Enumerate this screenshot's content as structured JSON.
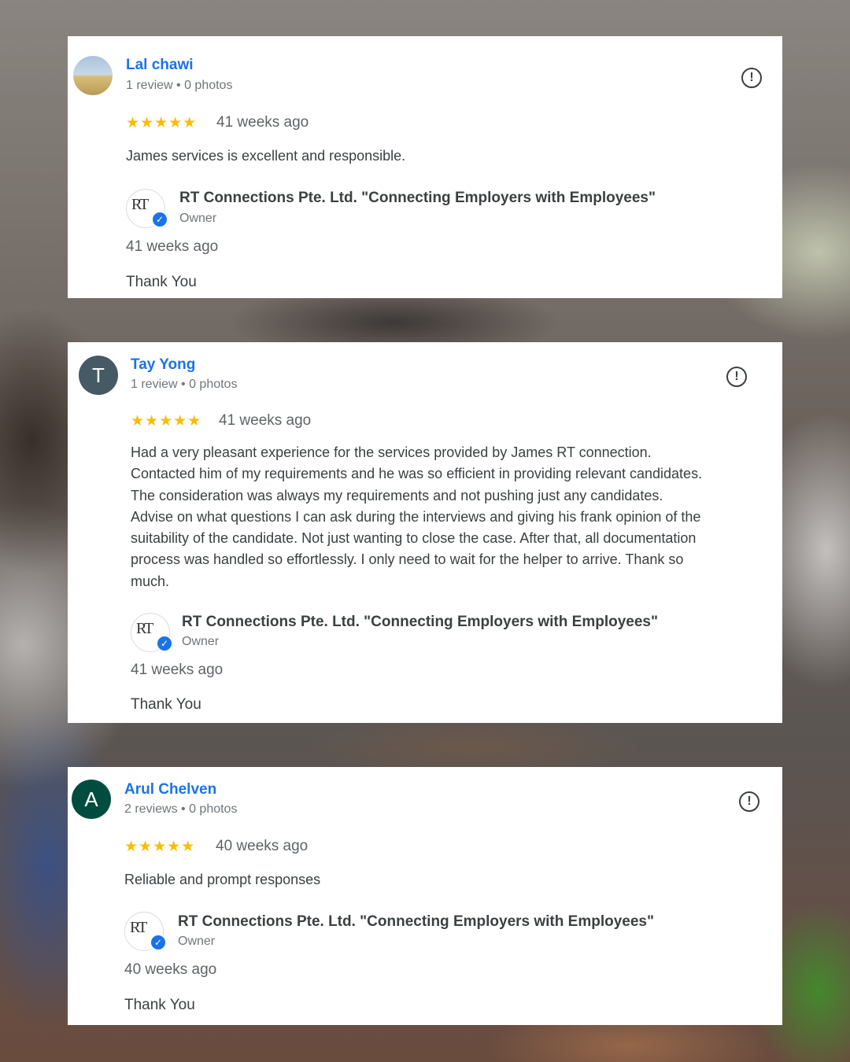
{
  "colors": {
    "link": "#1a73e8",
    "star": "#fbbc04",
    "text": "#3c4043",
    "muted": "#70757a"
  },
  "reviews": [
    {
      "author": "Lal chawi",
      "author_meta": "1 review • 0 photos",
      "avatar_type": "photo",
      "avatar_letter": "",
      "rating": 5,
      "stars": "★★★★★",
      "time": "41 weeks ago",
      "text": "James services is excellent and responsible.",
      "reply": {
        "owner": "RT Connections Pte. Ltd. \"Connecting Employers with Employees\"",
        "role": "Owner",
        "time": "41 weeks ago",
        "text": "Thank You"
      }
    },
    {
      "author": "Tay Yong",
      "author_meta": "1 review • 0 photos",
      "avatar_type": "letter",
      "avatar_letter": "T",
      "avatar_color": "#455a64",
      "rating": 5,
      "stars": "★★★★★",
      "time": "41 weeks ago",
      "text_lines": [
        "Had a very pleasant experience for the services provided by James RT connection.",
        "Contacted him of my requirements and he was so efficient in providing relevant candidates.",
        "The consideration was always my requirements and not pushing just any candidates.",
        "Advise on what questions I can ask during the interviews and giving his frank opinion of the",
        "suitability of the candidate. Not just wanting to close the case. After that, all documentation",
        "process was handled so effortlessly. I only need to wait for the helper to arrive. Thank so",
        "much."
      ],
      "reply": {
        "owner": "RT Connections Pte. Ltd. \"Connecting Employers with Employees\"",
        "role": "Owner",
        "time": "41 weeks ago",
        "text": "Thank You"
      }
    },
    {
      "author": "Arul Chelven",
      "author_meta": "2 reviews • 0 photos",
      "avatar_type": "letter",
      "avatar_letter": "A",
      "avatar_color": "#004d40",
      "rating": 5,
      "stars": "★★★★★",
      "time": "40 weeks ago",
      "text": "Reliable and prompt responses",
      "reply": {
        "owner": "RT Connections Pte. Ltd. \"Connecting Employers with Employees\"",
        "role": "Owner",
        "time": "40 weeks ago",
        "text": "Thank You"
      }
    }
  ],
  "icons": {
    "flag": "report-flag-icon",
    "verified": "verified-check-icon",
    "owner_logo": "rt-logo"
  },
  "owner_logo_text": "RT"
}
